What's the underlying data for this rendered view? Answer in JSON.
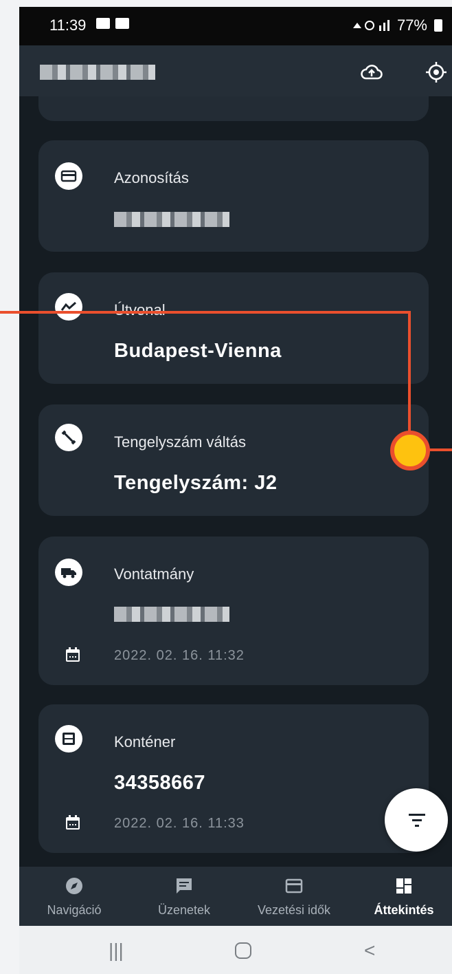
{
  "status_bar": {
    "time": "11:39",
    "battery": "77%"
  },
  "app_bar": {
    "upload_icon": "cloud-upload-icon",
    "locate_icon": "gps-target-icon"
  },
  "cards": [
    {
      "icon": "id-card-icon",
      "label": "Azonosítás"
    },
    {
      "icon": "route-icon",
      "label": "Útvonal",
      "value": "Budapest-Vienna"
    },
    {
      "icon": "axle-icon",
      "label": "Tengelyszám váltás",
      "value": "Tengelyszám: J2"
    },
    {
      "icon": "truck-icon",
      "label": "Vontatmány",
      "date": "2022. 02. 16. 11:32"
    },
    {
      "icon": "container-icon",
      "label": "Konténer",
      "value": "34358667",
      "date": "2022. 02. 16. 11:33"
    }
  ],
  "fab": {
    "icon": "filter-icon"
  },
  "bottom_nav": [
    {
      "label": "Navigáció",
      "icon": "compass-icon"
    },
    {
      "label": "Üzenetek",
      "icon": "message-icon"
    },
    {
      "label": "Vezetési idők",
      "icon": "card-icon"
    },
    {
      "label": "Áttekintés",
      "icon": "dashboard-icon",
      "active": true
    }
  ],
  "colors": {
    "background": "#151c22",
    "card": "#232c35",
    "bar": "#252e37",
    "annotation": "#ea4f2d",
    "annotation_dot": "#fec20f"
  }
}
